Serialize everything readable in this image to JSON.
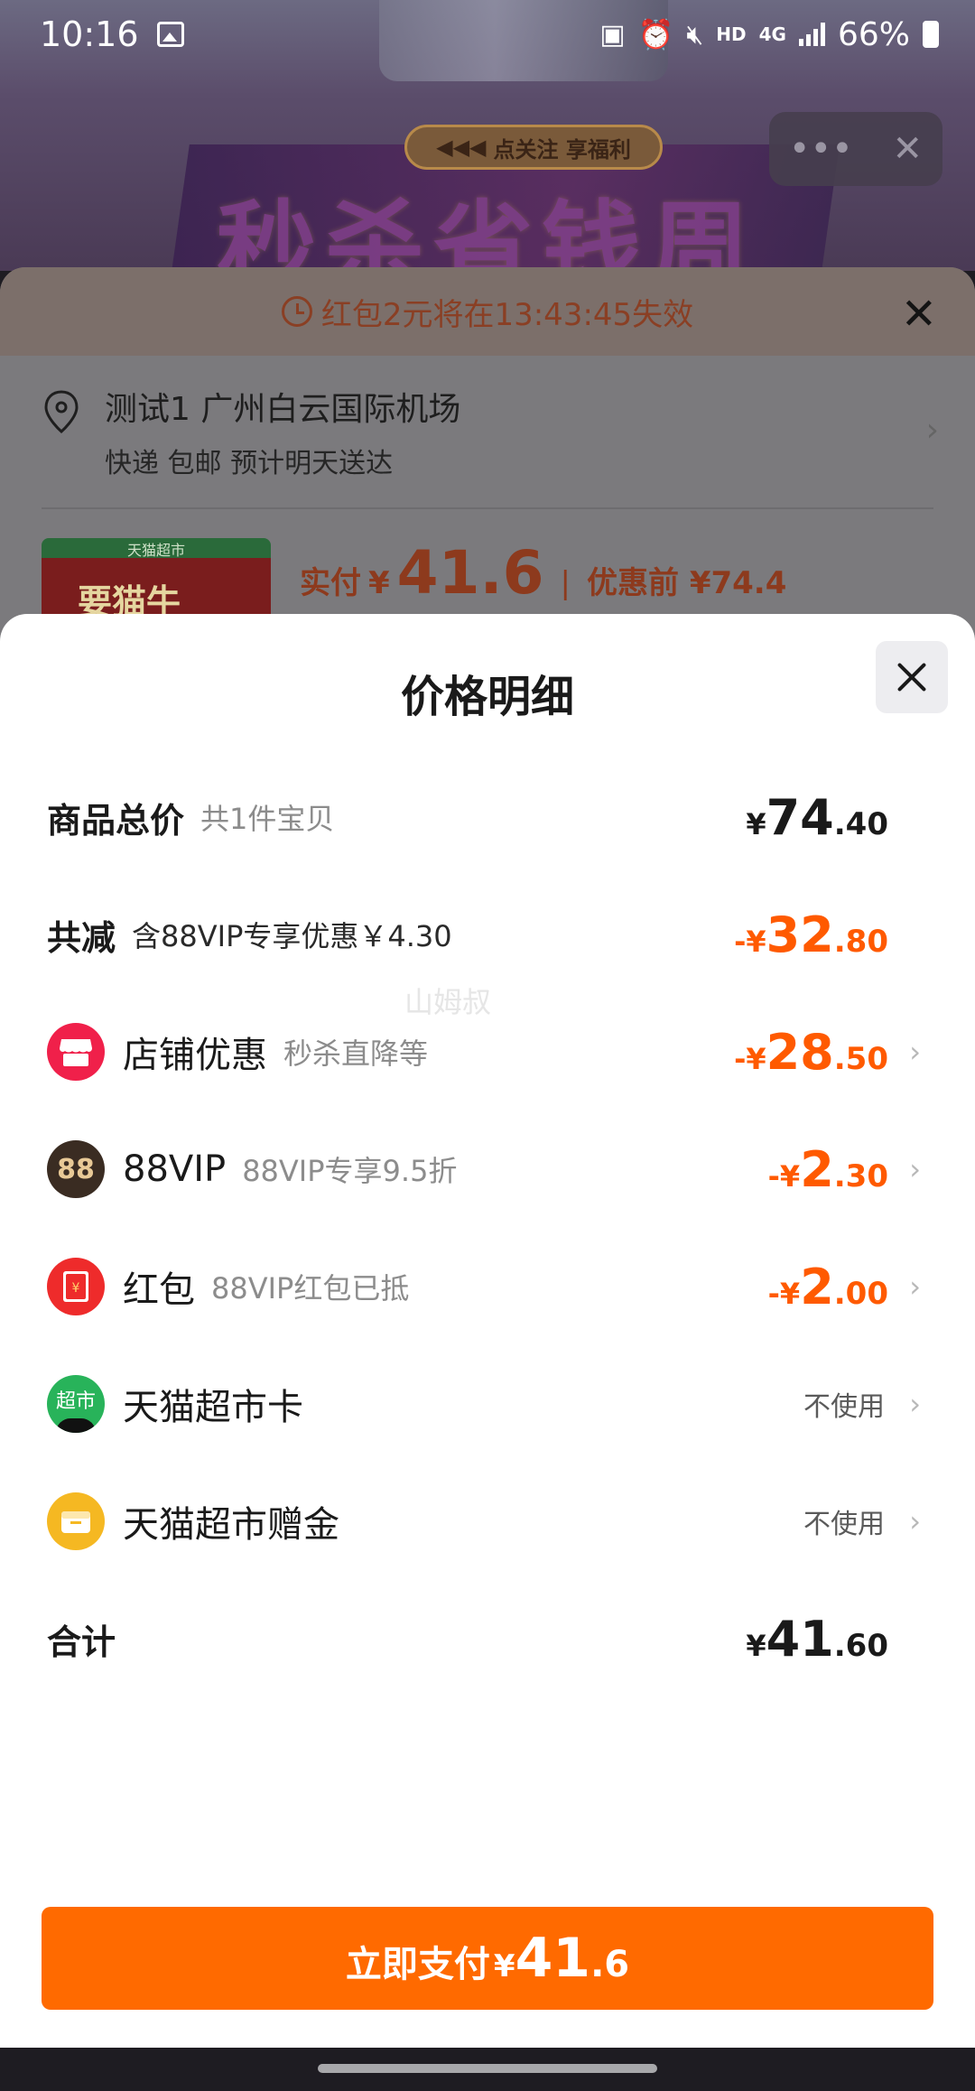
{
  "status_bar": {
    "time": "10:16",
    "hd": "HD",
    "net": "4G",
    "battery": "66%"
  },
  "background": {
    "follow_banner": "点关注 享福利",
    "banner_text": "秒杀省钱周",
    "notice": "红包2元将在13:43:45失效",
    "address_title": "测试1 广州白云国际机场",
    "address_sub": "快递 包邮 预计明天送达",
    "product_label": "天猫超市",
    "product_art": "要猫牛",
    "price_prefix": "实付",
    "price_currency": "¥",
    "price_value": "41.6",
    "price_before": "优惠前 ¥74.4"
  },
  "sheet": {
    "title": "价格明细",
    "total_goods": {
      "label": "商品总价",
      "sub": "共1件宝贝",
      "currency": "¥",
      "int": "74",
      "dec": ".40"
    },
    "total_discount": {
      "label": "共减",
      "sub": "含88VIP专享优惠￥4.30",
      "currency": "-¥",
      "int": "32",
      "dec": ".80"
    },
    "watermark": "山姆叔",
    "items": [
      {
        "label": "店铺优惠",
        "sub": "秒杀直降等",
        "currency": "-¥",
        "int": "28",
        "dec": ".50",
        "icon": "shop-icon",
        "icon_color": "#f0204a"
      },
      {
        "label": "88VIP",
        "sub": "88VIP专享9.5折",
        "currency": "-¥",
        "int": "2",
        "dec": ".30",
        "icon": "vip-88-icon",
        "icon_color": "#3a2c22"
      },
      {
        "label": "红包",
        "sub": "88VIP红包已抵",
        "currency": "-¥",
        "int": "2",
        "dec": ".00",
        "icon": "red-packet-icon",
        "icon_color": "#ee2b2b"
      },
      {
        "label": "天猫超市卡",
        "status": "不使用",
        "icon": "tmall-supermarket-card-icon",
        "icon_color": "#28b35a",
        "icon_text": "超市"
      },
      {
        "label": "天猫超市赠金",
        "status": "不使用",
        "icon": "gift-fund-icon",
        "icon_color": "#f5b822"
      }
    ],
    "sum": {
      "label": "合计",
      "currency": "¥",
      "int": "41",
      "dec": ".60"
    },
    "pay_button": {
      "label": "立即支付",
      "currency": "¥",
      "int": "41",
      "dec": ".6"
    }
  },
  "colors": {
    "accent_orange": "#ff6a00",
    "discount_orange": "#ff5a00"
  }
}
